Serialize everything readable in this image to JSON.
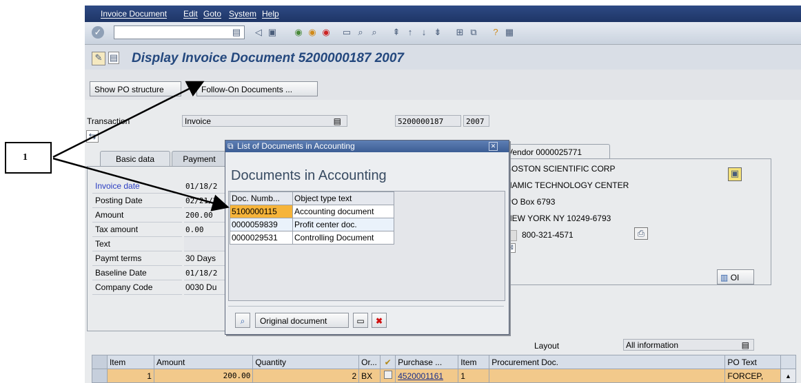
{
  "annotation": {
    "label": "1"
  },
  "menu": [
    "Invoice Document",
    "Edit",
    "Goto",
    "System",
    "Help"
  ],
  "title": "Display Invoice Document 5200000187 2007",
  "app_toolbar": {
    "show_po": "Show PO structure",
    "follow_on": "Follow-On Documents ..."
  },
  "header": {
    "transaction_label": "Transaction",
    "transaction_value": "Invoice",
    "doc_number": "5200000187",
    "fiscal_year": "2007"
  },
  "tabs": [
    "Basic data",
    "Payment"
  ],
  "basic_data": {
    "rows": [
      {
        "label": "Invoice date",
        "value": "01/18/2"
      },
      {
        "label": "Posting Date",
        "value": "02/21/2"
      },
      {
        "label": "Amount",
        "value": "200.00"
      },
      {
        "label": "Tax amount",
        "value": "0.00"
      },
      {
        "label": "Text",
        "value": ""
      },
      {
        "label": "Paymt terms",
        "value": "30 Days"
      },
      {
        "label": "Baseline Date",
        "value": "01/18/2"
      },
      {
        "label": "Company Code",
        "value": "0030 Du"
      }
    ]
  },
  "vendor": {
    "tab": "Vendor 0000025771",
    "lines": [
      "BOSTON SCIENTIFIC CORP",
      "NAMIC TECHNOLOGY CENTER",
      "PO Box 6793",
      "NEW YORK NY  10249-6793"
    ],
    "phone": "800-321-4571",
    "oi_button": "OI"
  },
  "popup": {
    "title": "List of Documents in Accounting",
    "heading": "Documents in Accounting",
    "columns": [
      "Doc. Numb...",
      "Object type text"
    ],
    "rows": [
      {
        "doc": "5100000115",
        "type": "Accounting document"
      },
      {
        "doc": "0000059839",
        "type": "Profit center doc."
      },
      {
        "doc": "0000029531",
        "type": "Controlling Document"
      }
    ],
    "original_doc_button": "Original document"
  },
  "layout": {
    "label": "Layout",
    "value": "All information"
  },
  "items_table": {
    "columns": [
      "Item",
      "Amount",
      "Quantity",
      "Or...",
      "",
      "Purchase ...",
      "Item",
      "Procurement Doc.",
      "PO Text"
    ],
    "rows": [
      {
        "item": "1",
        "amount": "200.00",
        "quantity": "2",
        "unit": "BX",
        "purchase": "4520001161",
        "po_item": "1",
        "proc_doc": "",
        "po_text": "FORCEP,"
      }
    ]
  },
  "colors": {
    "menubar": "#1e3566",
    "title": "#24487e",
    "selected_cell": "#f6b43a",
    "item_row": "#f2c98b"
  }
}
